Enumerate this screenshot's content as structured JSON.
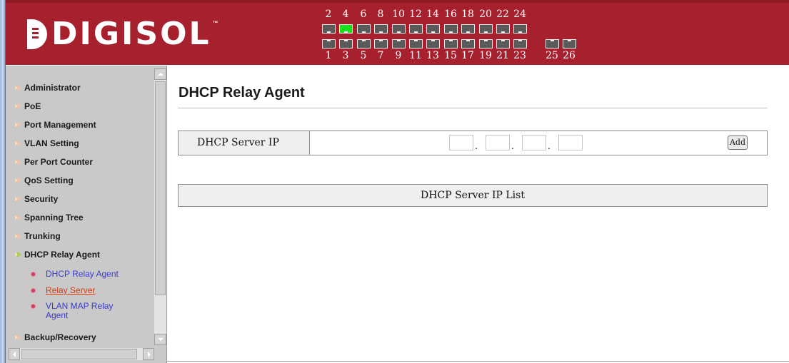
{
  "header": {
    "logo_text": "DIGISOL",
    "logo_tm": "™",
    "accent_color": "#a6212d",
    "ports_top": [
      "2",
      "4",
      "6",
      "8",
      "10",
      "12",
      "14",
      "16",
      "18",
      "20",
      "22",
      "24"
    ],
    "ports_bottom": [
      "1",
      "3",
      "5",
      "7",
      "9",
      "11",
      "13",
      "15",
      "17",
      "19",
      "21",
      "23"
    ],
    "ports_extra": [
      "25",
      "26"
    ],
    "active_port": "4"
  },
  "sidebar": {
    "items": [
      {
        "label": "Administrator"
      },
      {
        "label": "PoE"
      },
      {
        "label": "Port Management"
      },
      {
        "label": "VLAN Setting"
      },
      {
        "label": "Per Port Counter"
      },
      {
        "label": "QoS Setting"
      },
      {
        "label": "Security"
      },
      {
        "label": "Spanning Tree"
      },
      {
        "label": "Trunking"
      },
      {
        "label": "DHCP Relay Agent"
      },
      {
        "label": "Backup/Recovery"
      }
    ],
    "sub_items": [
      {
        "label": "DHCP Relay Agent"
      },
      {
        "label": "Relay Server"
      },
      {
        "label": "VLAN MAP Relay Agent"
      }
    ]
  },
  "main": {
    "title": "DHCP Relay Agent",
    "server_ip_label": "DHCP Server IP",
    "ip_octets": [
      "",
      "",
      "",
      ""
    ],
    "ip_separator": ".",
    "add_label": "Add",
    "list_header": "DHCP Server IP List"
  }
}
